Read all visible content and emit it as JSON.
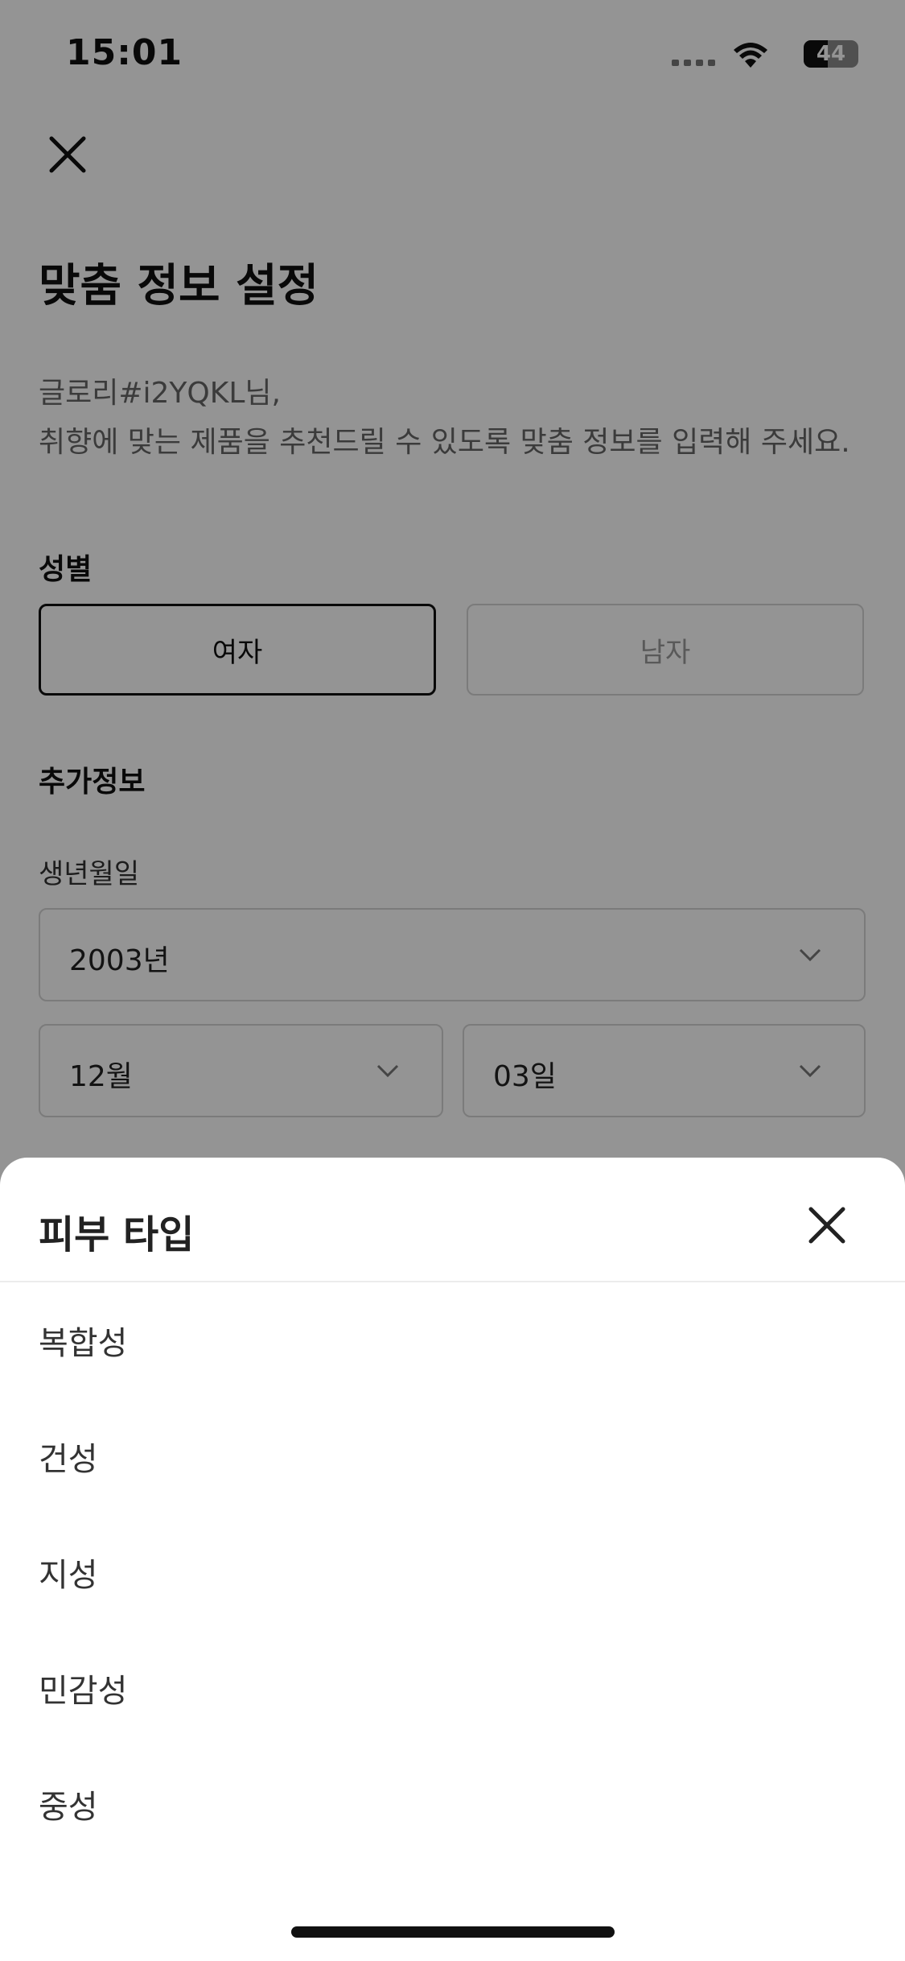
{
  "status_bar": {
    "time": "15:01",
    "battery": "44",
    "battery_level": 0.44,
    "icons": [
      "signal-icon",
      "wifi-icon",
      "battery-icon"
    ]
  },
  "page": {
    "close_icon": "close-icon",
    "title": "맞춤 정보 설정",
    "description_line1": "글로리#i2YQKL님,",
    "description_line2": "취향에 맞는 제품을 추천드릴 수 있도록 맞춤 정보를 입력해 주세요.",
    "gender": {
      "label": "성별",
      "options": [
        "여자",
        "남자"
      ],
      "selected": "여자"
    },
    "additional": {
      "label": "추가정보",
      "birth_label": "생년월일",
      "year": "2003년",
      "month": "12월",
      "day": "03일",
      "chevron_icon": "chevron-down-icon"
    }
  },
  "sheet": {
    "title": "피부 타입",
    "close_icon": "close-icon",
    "options": [
      "복합성",
      "건성",
      "지성",
      "민감성",
      "중성"
    ]
  },
  "colors": {
    "overlay": "rgba(0,0,0,0.42)",
    "text_primary": "#111111",
    "text_muted": "#666666",
    "border": "#d4d4d4"
  }
}
